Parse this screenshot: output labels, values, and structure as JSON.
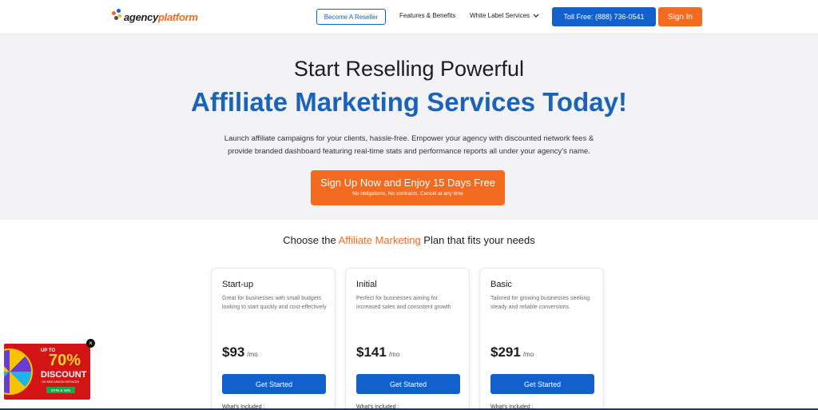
{
  "header": {
    "logo_part1": "agency",
    "logo_part2": "platform",
    "reseller_label": "Become A Reseller",
    "features_label": "Features & Benefits",
    "white_label": "White Label Services",
    "toll_free": "Toll Free: (888) 736-0541",
    "signin": "Sign In"
  },
  "hero": {
    "line1": "Start Reselling Powerful",
    "line2": "Affiliate Marketing Services Today!",
    "desc1": "Launch affiliate campaigns for your clients, hassle-free. Empower your agency with discounted network fees &",
    "desc2": "provide branded dashboard featuring real-time stats and performance reports all under your agency's name.",
    "cta_title": "Sign Up Now and Enjoy 15 Days Free",
    "cta_sub": "No obligations, No contracts, Cancel at any time"
  },
  "plans": {
    "title_pre": "Choose the ",
    "title_hl": "Affiliate Marketing",
    "title_post": " Plan that fits your needs",
    "items": [
      {
        "name": "Start-up",
        "desc": "Great for businesses with small budgets looking to start quickly and cost-effectively",
        "price": "$93",
        "per": "/mo",
        "button": "Get Started",
        "included": "What's Included :"
      },
      {
        "name": "Initial",
        "desc": "Perfect for businesses aiming for increased sales and consistent growth",
        "price": "$141",
        "per": "/mo",
        "button": "Get Started",
        "included": "What's Included :"
      },
      {
        "name": "Basic",
        "desc": "Tailored for growing businesses seeking steady and reliable conversions.",
        "price": "$291",
        "per": "/mo",
        "button": "Get Started",
        "included": "What's Included :"
      }
    ]
  },
  "promo": {
    "up_to": "UP TO",
    "percent": "70%",
    "discount": "DISCOUNT",
    "small": "ON WEB DESIGN SERVICES",
    "spin": "SPIN & WIN",
    "close": "×"
  },
  "colors": {
    "brand_blue": "#1260cc",
    "accent_orange": "#f26b21",
    "headline_blue": "#1a63b8"
  }
}
